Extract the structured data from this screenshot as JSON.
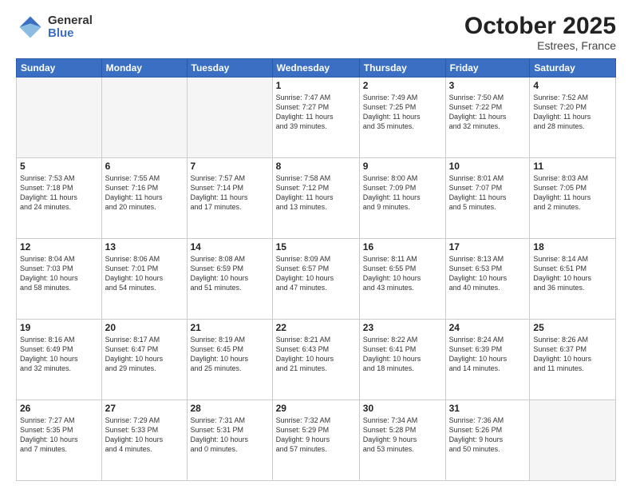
{
  "logo": {
    "general": "General",
    "blue": "Blue"
  },
  "header": {
    "month": "October 2025",
    "location": "Estrees, France"
  },
  "weekdays": [
    "Sunday",
    "Monday",
    "Tuesday",
    "Wednesday",
    "Thursday",
    "Friday",
    "Saturday"
  ],
  "weeks": [
    [
      {
        "day": "",
        "info": ""
      },
      {
        "day": "",
        "info": ""
      },
      {
        "day": "",
        "info": ""
      },
      {
        "day": "1",
        "info": "Sunrise: 7:47 AM\nSunset: 7:27 PM\nDaylight: 11 hours\nand 39 minutes."
      },
      {
        "day": "2",
        "info": "Sunrise: 7:49 AM\nSunset: 7:25 PM\nDaylight: 11 hours\nand 35 minutes."
      },
      {
        "day": "3",
        "info": "Sunrise: 7:50 AM\nSunset: 7:22 PM\nDaylight: 11 hours\nand 32 minutes."
      },
      {
        "day": "4",
        "info": "Sunrise: 7:52 AM\nSunset: 7:20 PM\nDaylight: 11 hours\nand 28 minutes."
      }
    ],
    [
      {
        "day": "5",
        "info": "Sunrise: 7:53 AM\nSunset: 7:18 PM\nDaylight: 11 hours\nand 24 minutes."
      },
      {
        "day": "6",
        "info": "Sunrise: 7:55 AM\nSunset: 7:16 PM\nDaylight: 11 hours\nand 20 minutes."
      },
      {
        "day": "7",
        "info": "Sunrise: 7:57 AM\nSunset: 7:14 PM\nDaylight: 11 hours\nand 17 minutes."
      },
      {
        "day": "8",
        "info": "Sunrise: 7:58 AM\nSunset: 7:12 PM\nDaylight: 11 hours\nand 13 minutes."
      },
      {
        "day": "9",
        "info": "Sunrise: 8:00 AM\nSunset: 7:09 PM\nDaylight: 11 hours\nand 9 minutes."
      },
      {
        "day": "10",
        "info": "Sunrise: 8:01 AM\nSunset: 7:07 PM\nDaylight: 11 hours\nand 5 minutes."
      },
      {
        "day": "11",
        "info": "Sunrise: 8:03 AM\nSunset: 7:05 PM\nDaylight: 11 hours\nand 2 minutes."
      }
    ],
    [
      {
        "day": "12",
        "info": "Sunrise: 8:04 AM\nSunset: 7:03 PM\nDaylight: 10 hours\nand 58 minutes."
      },
      {
        "day": "13",
        "info": "Sunrise: 8:06 AM\nSunset: 7:01 PM\nDaylight: 10 hours\nand 54 minutes."
      },
      {
        "day": "14",
        "info": "Sunrise: 8:08 AM\nSunset: 6:59 PM\nDaylight: 10 hours\nand 51 minutes."
      },
      {
        "day": "15",
        "info": "Sunrise: 8:09 AM\nSunset: 6:57 PM\nDaylight: 10 hours\nand 47 minutes."
      },
      {
        "day": "16",
        "info": "Sunrise: 8:11 AM\nSunset: 6:55 PM\nDaylight: 10 hours\nand 43 minutes."
      },
      {
        "day": "17",
        "info": "Sunrise: 8:13 AM\nSunset: 6:53 PM\nDaylight: 10 hours\nand 40 minutes."
      },
      {
        "day": "18",
        "info": "Sunrise: 8:14 AM\nSunset: 6:51 PM\nDaylight: 10 hours\nand 36 minutes."
      }
    ],
    [
      {
        "day": "19",
        "info": "Sunrise: 8:16 AM\nSunset: 6:49 PM\nDaylight: 10 hours\nand 32 minutes."
      },
      {
        "day": "20",
        "info": "Sunrise: 8:17 AM\nSunset: 6:47 PM\nDaylight: 10 hours\nand 29 minutes."
      },
      {
        "day": "21",
        "info": "Sunrise: 8:19 AM\nSunset: 6:45 PM\nDaylight: 10 hours\nand 25 minutes."
      },
      {
        "day": "22",
        "info": "Sunrise: 8:21 AM\nSunset: 6:43 PM\nDaylight: 10 hours\nand 21 minutes."
      },
      {
        "day": "23",
        "info": "Sunrise: 8:22 AM\nSunset: 6:41 PM\nDaylight: 10 hours\nand 18 minutes."
      },
      {
        "day": "24",
        "info": "Sunrise: 8:24 AM\nSunset: 6:39 PM\nDaylight: 10 hours\nand 14 minutes."
      },
      {
        "day": "25",
        "info": "Sunrise: 8:26 AM\nSunset: 6:37 PM\nDaylight: 10 hours\nand 11 minutes."
      }
    ],
    [
      {
        "day": "26",
        "info": "Sunrise: 7:27 AM\nSunset: 5:35 PM\nDaylight: 10 hours\nand 7 minutes."
      },
      {
        "day": "27",
        "info": "Sunrise: 7:29 AM\nSunset: 5:33 PM\nDaylight: 10 hours\nand 4 minutes."
      },
      {
        "day": "28",
        "info": "Sunrise: 7:31 AM\nSunset: 5:31 PM\nDaylight: 10 hours\nand 0 minutes."
      },
      {
        "day": "29",
        "info": "Sunrise: 7:32 AM\nSunset: 5:29 PM\nDaylight: 9 hours\nand 57 minutes."
      },
      {
        "day": "30",
        "info": "Sunrise: 7:34 AM\nSunset: 5:28 PM\nDaylight: 9 hours\nand 53 minutes."
      },
      {
        "day": "31",
        "info": "Sunrise: 7:36 AM\nSunset: 5:26 PM\nDaylight: 9 hours\nand 50 minutes."
      },
      {
        "day": "",
        "info": ""
      }
    ]
  ]
}
